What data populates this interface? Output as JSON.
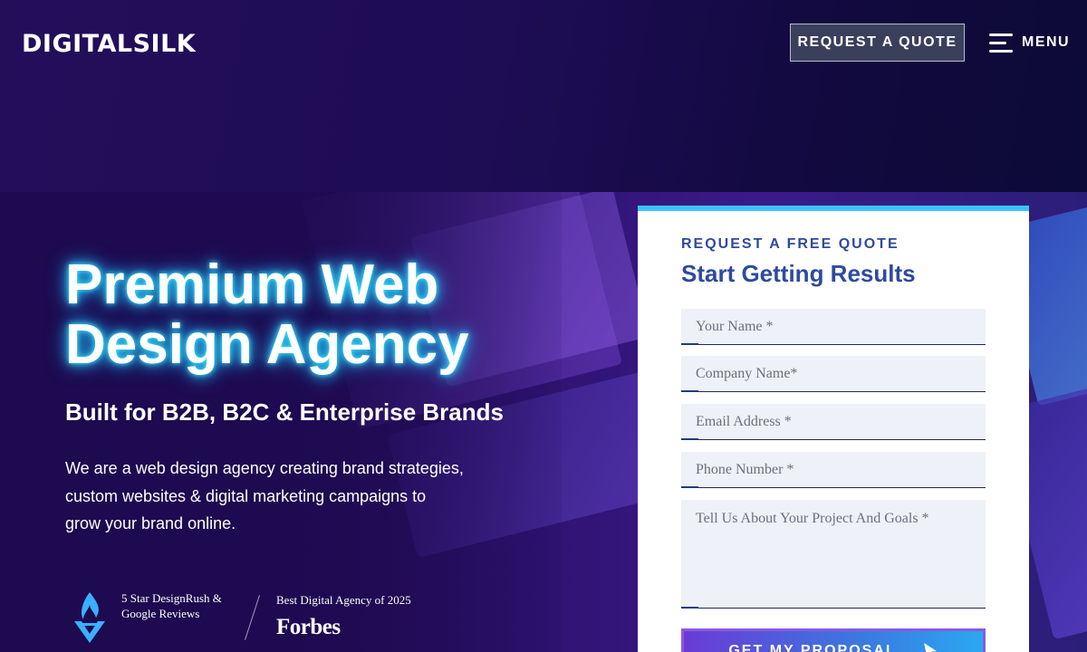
{
  "header": {
    "logo": "DIGITALSILK",
    "quote_button": "REQUEST A QUOTE",
    "menu_label": "MENU"
  },
  "hero": {
    "title": "Premium Web Design Agency",
    "subtitle": "Built for B2B, B2C & Enterprise Brands",
    "description": "We are a web design agency creating brand strategies, custom websites & digital marketing campaigns to grow your brand online."
  },
  "badges": {
    "designrush": "5 Star DesignRush & Google Reviews",
    "forbes_caption": "Best Digital Agency of 2025",
    "forbes_logo": "Forbes"
  },
  "form": {
    "eyebrow": "REQUEST A FREE QUOTE",
    "heading": "Start Getting Results",
    "fields": {
      "name": "Your Name *",
      "company": "Company Name*",
      "email": "Email Address *",
      "phone": "Phone Number *",
      "project": "Tell Us About Your Project And Goals *"
    },
    "submit": "GET MY PROPOSAL"
  },
  "colors": {
    "background": "#1c0a4e",
    "form_accent": "#3cc2ff",
    "form_text": "#2e4aa0",
    "title_glow": "#26c6ff"
  }
}
